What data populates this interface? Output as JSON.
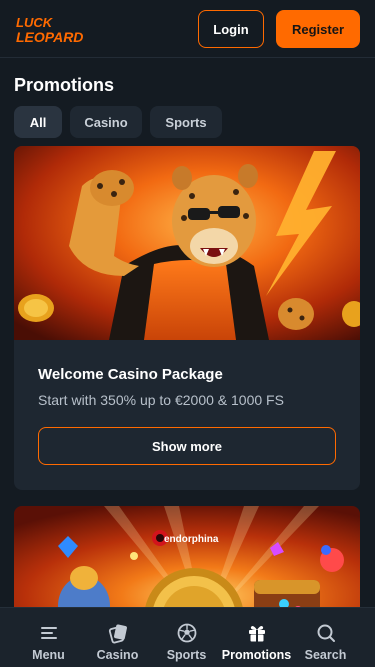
{
  "brand": {
    "logo_line1": "LUCK",
    "logo_line2": "LEOPARD",
    "accent_color": "#ff6a00"
  },
  "header": {
    "login_label": "Login",
    "register_label": "Register"
  },
  "page": {
    "title": "Promotions"
  },
  "tabs": [
    {
      "label": "All",
      "active": true
    },
    {
      "label": "Casino",
      "active": false
    },
    {
      "label": "Sports",
      "active": false
    }
  ],
  "promotions": [
    {
      "title": "Welcome Casino Package",
      "subtitle": "Start with 350% up to €2000 & 1000 FS",
      "button_label": "Show more",
      "image": "leopard-with-sunglasses"
    },
    {
      "provider_label": "endorphina",
      "image": "endorphina-slots-banner"
    }
  ],
  "bottom_nav": [
    {
      "label": "Menu",
      "icon": "menu-icon",
      "active": false
    },
    {
      "label": "Casino",
      "icon": "casino-chip-icon",
      "active": false
    },
    {
      "label": "Sports",
      "icon": "soccer-ball-icon",
      "active": false
    },
    {
      "label": "Promotions",
      "icon": "gift-icon",
      "active": true
    },
    {
      "label": "Search",
      "icon": "search-icon",
      "active": false
    }
  ]
}
